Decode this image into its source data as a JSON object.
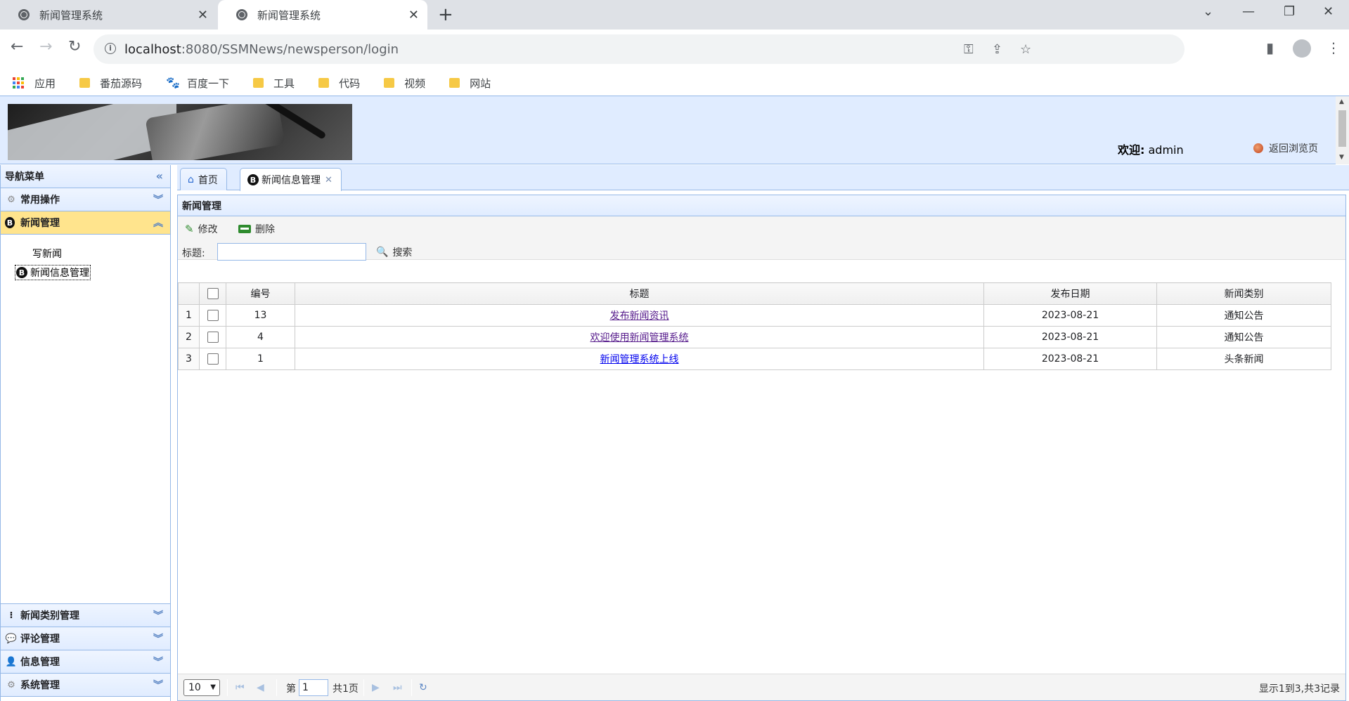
{
  "browser": {
    "tabs": [
      {
        "title": "新闻管理系统",
        "active": false
      },
      {
        "title": "新闻管理系统",
        "active": true
      }
    ],
    "url_host": "localhost",
    "url_path": ":8080/SSMNews/newsperson/login",
    "bookmarks": [
      {
        "label": "应用",
        "icon": "apps-grid-icon"
      },
      {
        "label": "番茄源码",
        "icon": "folder-icon"
      },
      {
        "label": "百度一下",
        "icon": "baidu-paw-icon"
      },
      {
        "label": "工具",
        "icon": "folder-icon"
      },
      {
        "label": "代码",
        "icon": "folder-icon"
      },
      {
        "label": "视频",
        "icon": "folder-icon"
      },
      {
        "label": "网站",
        "icon": "folder-icon"
      }
    ]
  },
  "header": {
    "welcome_label": "欢迎:",
    "username": "admin",
    "back_link": "返回浏览页"
  },
  "nav": {
    "title": "导航菜单",
    "sections": [
      {
        "label": "常用操作",
        "icon": "gear-icon",
        "expanded": false
      },
      {
        "label": "新闻管理",
        "icon": "blog-b-icon",
        "expanded": true,
        "items": [
          {
            "label": "写新闻",
            "selected": false
          },
          {
            "label": "新闻信息管理",
            "selected": true
          }
        ]
      },
      {
        "label": "新闻类别管理",
        "icon": "tree-icon",
        "expanded": false
      },
      {
        "label": "评论管理",
        "icon": "comment-icon",
        "expanded": false
      },
      {
        "label": "信息管理",
        "icon": "user-icon",
        "expanded": false
      },
      {
        "label": "系统管理",
        "icon": "system-icon",
        "expanded": false
      }
    ]
  },
  "panel_tabs": [
    {
      "label": "首页",
      "icon": "home-icon",
      "closable": false,
      "active": false
    },
    {
      "label": "新闻信息管理",
      "icon": "blog-b-icon",
      "closable": true,
      "active": true
    }
  ],
  "grid": {
    "title": "新闻管理",
    "toolbar": {
      "edit": "修改",
      "delete": "删除"
    },
    "search": {
      "label": "标题:",
      "value": "",
      "button": "搜索"
    },
    "columns": [
      "编号",
      "标题",
      "发布日期",
      "新闻类别"
    ],
    "rows": [
      {
        "rownum": "1",
        "id": "13",
        "title": "发布新闻资讯",
        "date": "2023-08-21",
        "category": "通知公告",
        "visited": true
      },
      {
        "rownum": "2",
        "id": "4",
        "title": "欢迎使用新闻管理系统",
        "date": "2023-08-21",
        "category": "通知公告",
        "visited": true
      },
      {
        "rownum": "3",
        "id": "1",
        "title": "新闻管理系统上线",
        "date": "2023-08-21",
        "category": "头条新闻",
        "visited": false
      }
    ]
  },
  "pager": {
    "page_size": "10",
    "page_prefix": "第",
    "page_number": "1",
    "page_total": "共1页",
    "info": "显示1到3,共3记录"
  },
  "colors": {
    "panel_header": "#e0ecff",
    "border": "#95b8e7",
    "selected_section": "#ffe48d",
    "link": "#0000ee",
    "visited_link": "#551a8b"
  }
}
